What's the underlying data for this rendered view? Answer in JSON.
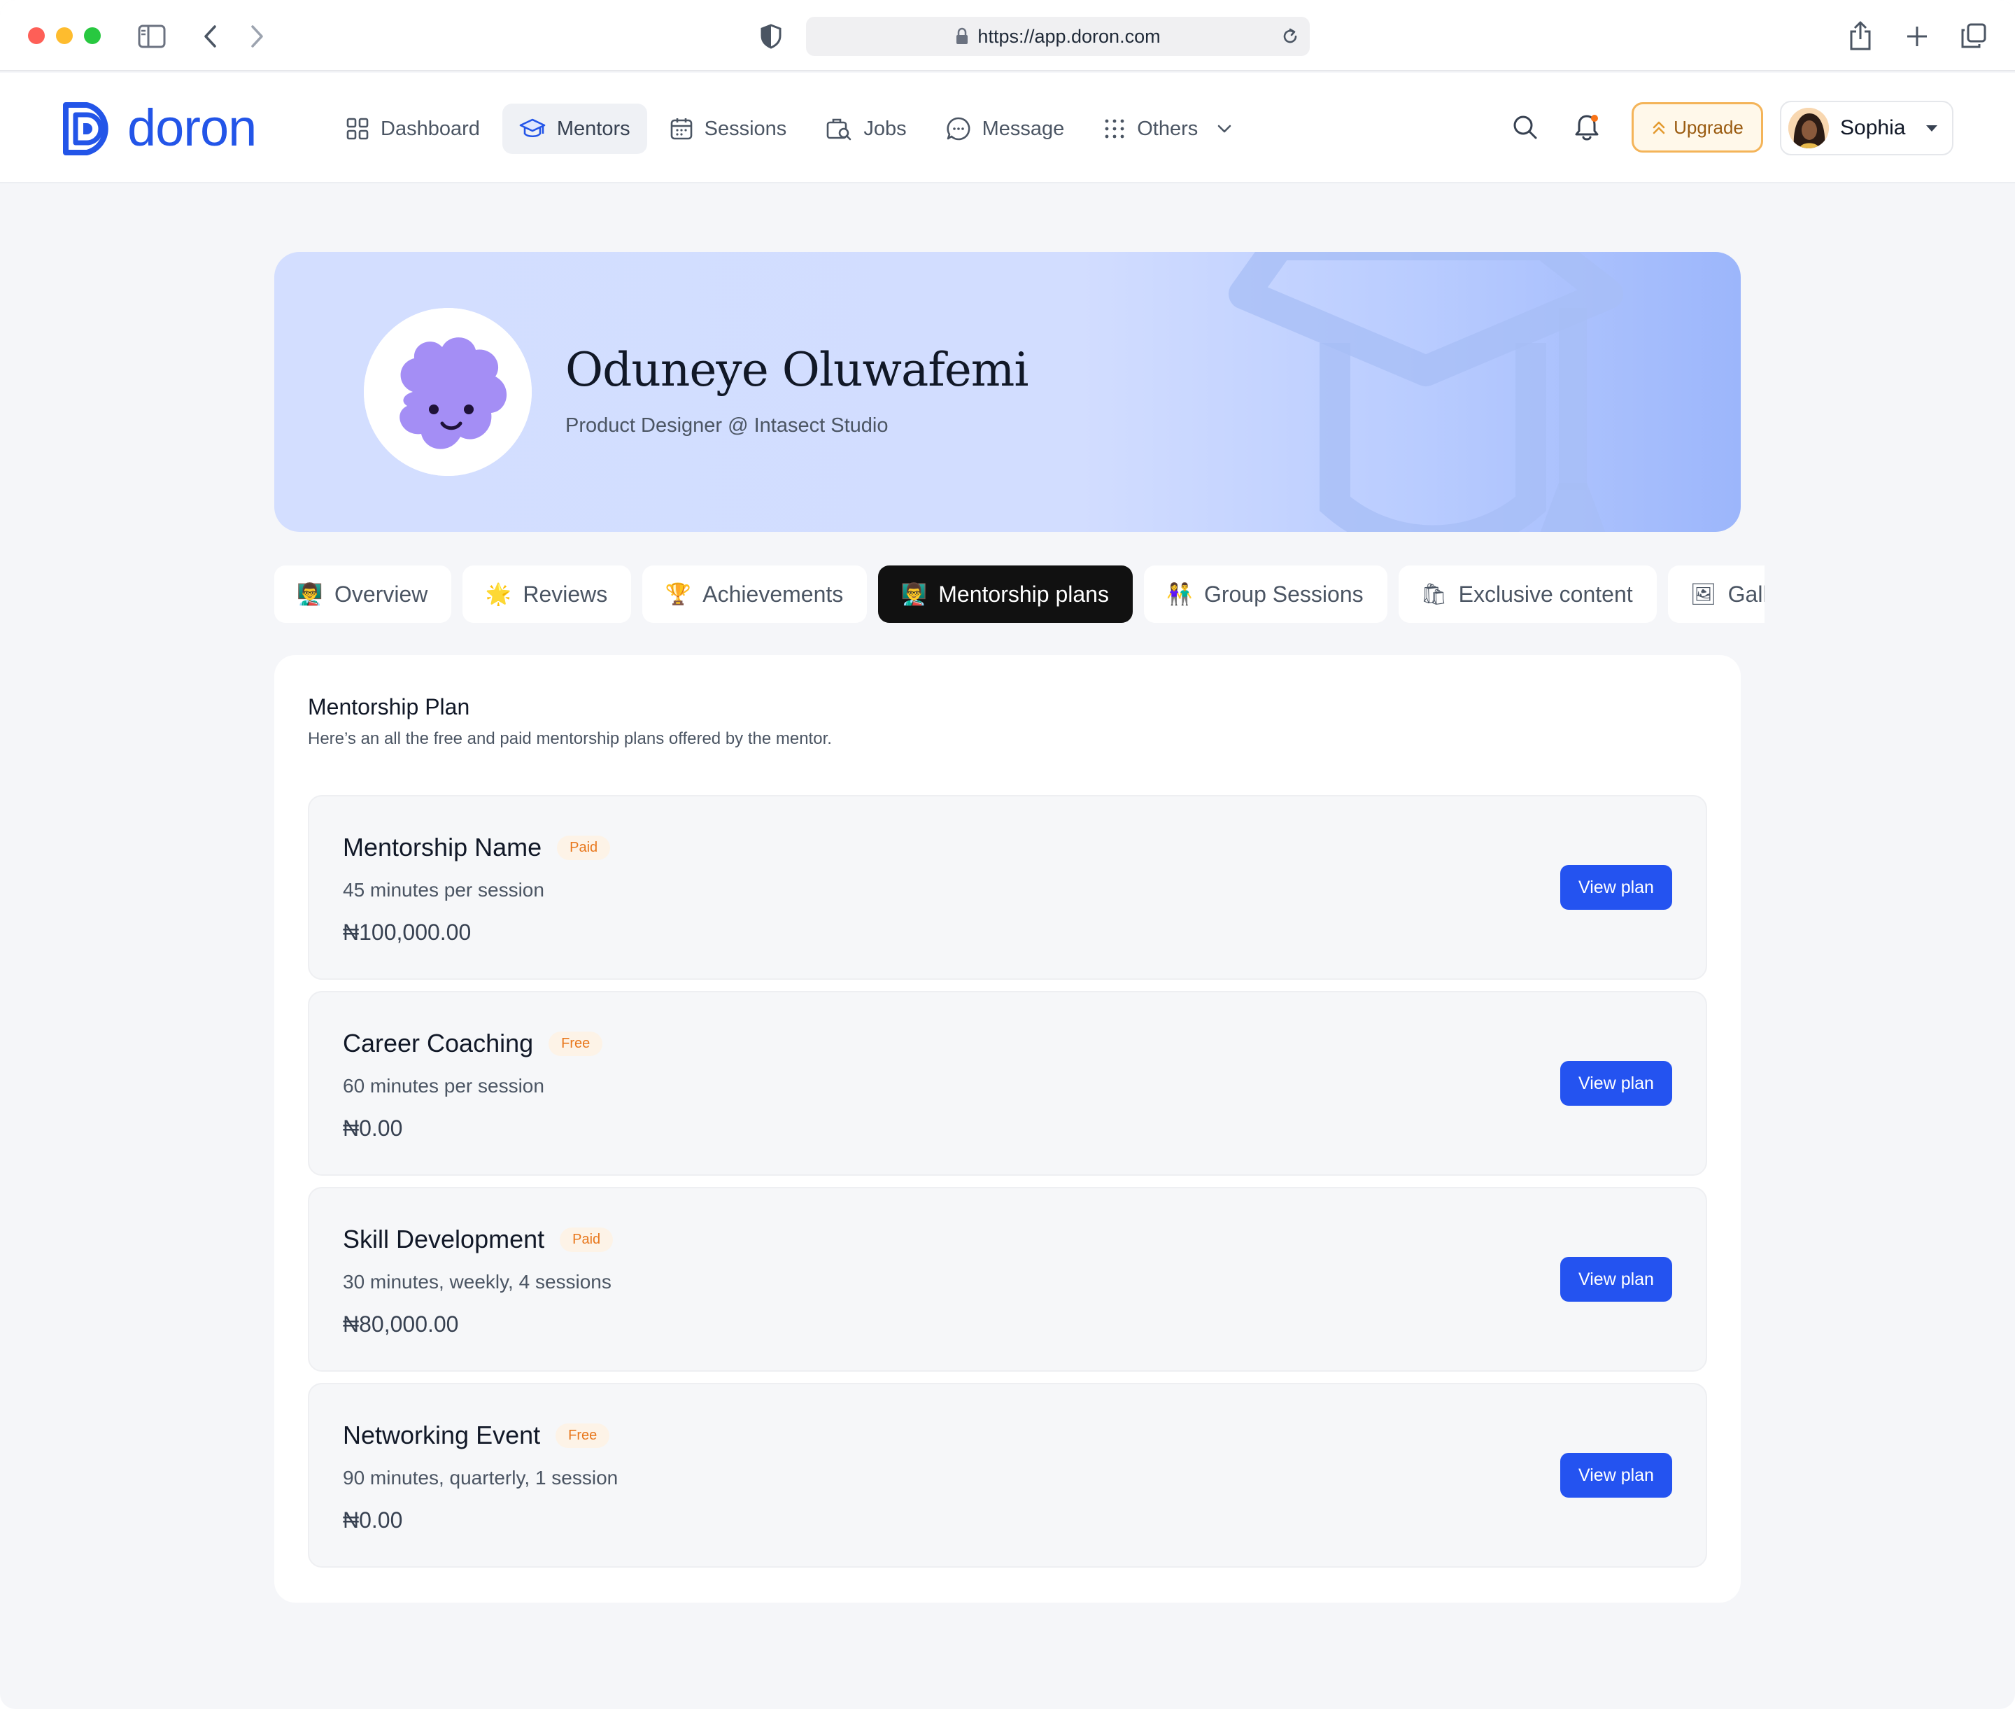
{
  "browser": {
    "url": "https://app.doron.com"
  },
  "app": {
    "logo_text": "doron",
    "brand_color": "#2355e8"
  },
  "nav": {
    "items": [
      {
        "label": "Dashboard",
        "icon": "grid-icon"
      },
      {
        "label": "Mentors",
        "icon": "graduation-cap-icon",
        "active": true
      },
      {
        "label": "Sessions",
        "icon": "calendar-icon"
      },
      {
        "label": "Jobs",
        "icon": "briefcase-search-icon"
      },
      {
        "label": "Message",
        "icon": "chat-bubble-icon"
      },
      {
        "label": "Others",
        "icon": "dots-grid-icon"
      }
    ]
  },
  "header": {
    "upgrade_label": "Upgrade",
    "user_name": "Sophia"
  },
  "hero": {
    "name": "Oduneye Oluwafemi",
    "role": "Product Designer @ Intasect Studio"
  },
  "tabs": [
    {
      "label": "Overview",
      "emoji": "👨‍🏫"
    },
    {
      "label": "Reviews",
      "emoji": "🌟"
    },
    {
      "label": "Achievements",
      "emoji": "🏆"
    },
    {
      "label": "Mentorship plans",
      "emoji": "👨‍🏫",
      "active": true
    },
    {
      "label": "Group Sessions",
      "emoji": "👫"
    },
    {
      "label": "Exclusive content",
      "emoji": "🛍"
    },
    {
      "label": "Gall",
      "emoji": "🖼"
    }
  ],
  "mentorship": {
    "title": "Mentorship Plan",
    "subtitle": "Here’s an all the free and paid mentorship plans offered by the mentor.",
    "view_label": "View plan",
    "plans": [
      {
        "name": "Mentorship Name",
        "badge": "Paid",
        "duration": "45 minutes per session",
        "price": "₦100,000.00"
      },
      {
        "name": "Career Coaching",
        "badge": "Free",
        "duration": "60 minutes per session",
        "price": "₦0.00"
      },
      {
        "name": "Skill Development",
        "badge": "Paid",
        "duration": "30 minutes, weekly, 4 sessions",
        "price": "₦80,000.00"
      },
      {
        "name": "Networking Event",
        "badge": "Free",
        "duration": "90 minutes, quarterly, 1 session",
        "price": "₦0.00"
      }
    ]
  },
  "colors": {
    "primary_button": "#2453f0",
    "badge_text": "#e8771c",
    "upgrade_border": "#f4b459"
  }
}
